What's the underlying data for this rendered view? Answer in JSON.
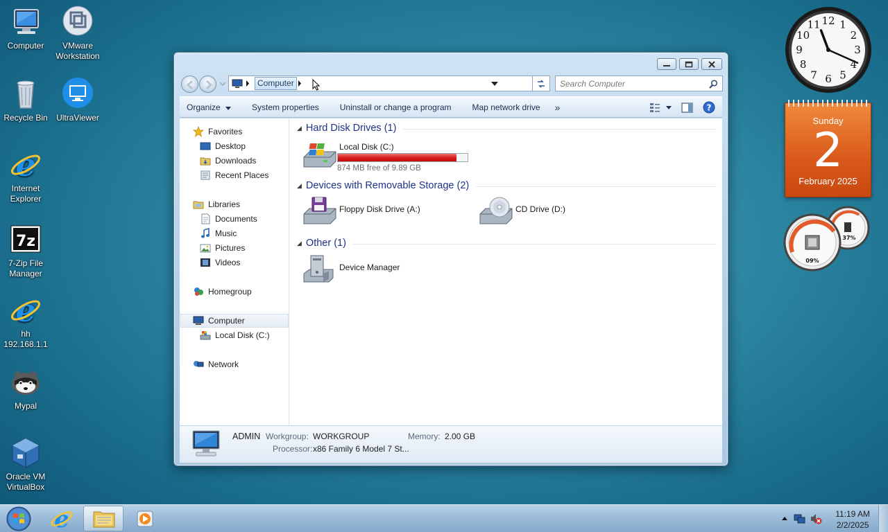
{
  "desktop": {
    "icons": [
      {
        "label": "Computer",
        "icon": "computer-icon"
      },
      {
        "label": "VMware\nWorkstation",
        "icon": "vmware-icon"
      },
      {
        "label": "Recycle Bin",
        "icon": "recycle-bin-icon"
      },
      {
        "label": "UltraViewer",
        "icon": "ultraviewer-icon"
      },
      {
        "label": "Internet\nExplorer",
        "icon": "internet-explorer-icon"
      },
      {
        "label": "7-Zip File\nManager",
        "icon": "7zip-icon"
      },
      {
        "label": "hh\n192.168.1.1",
        "icon": "internet-explorer-icon"
      },
      {
        "label": "Mypal",
        "icon": "mypal-icon"
      },
      {
        "label": "Oracle VM\nVirtualBox",
        "icon": "virtualbox-icon"
      }
    ]
  },
  "window": {
    "address": {
      "crumb": "Computer"
    },
    "search": {
      "placeholder": "Search Computer"
    },
    "toolbar": {
      "organize": "Organize",
      "system_properties": "System properties",
      "uninstall": "Uninstall or change a program",
      "map_drive": "Map network drive",
      "more": "»"
    },
    "nav": {
      "favorites": "Favorites",
      "desktop": "Desktop",
      "downloads": "Downloads",
      "recent_places": "Recent Places",
      "libraries": "Libraries",
      "documents": "Documents",
      "music": "Music",
      "pictures": "Pictures",
      "videos": "Videos",
      "homegroup": "Homegroup",
      "computer": "Computer",
      "local_disk": "Local Disk (C:)",
      "network": "Network"
    },
    "groups": {
      "hdd": "Hard Disk Drives (1)",
      "removable": "Devices with Removable Storage (2)",
      "other": "Other (1)"
    },
    "items": {
      "local_disk": {
        "name": "Local Disk (C:)",
        "free": "874 MB free of 9.89 GB",
        "used_fraction": 0.914
      },
      "floppy": {
        "name": "Floppy Disk Drive (A:)"
      },
      "cd": {
        "name": "CD Drive (D:)"
      },
      "device_manager": {
        "name": "Device Manager"
      }
    },
    "details": {
      "name": "ADMIN",
      "workgroup_label": "Workgroup:",
      "workgroup": "WORKGROUP",
      "memory_label": "Memory:",
      "memory": "2.00 GB",
      "processor_label": "Processor:",
      "processor": "x86 Family 6 Model 7 St..."
    }
  },
  "gadgets": {
    "clock": {
      "hour": 11,
      "minute": 19
    },
    "calendar": {
      "weekday": "Sunday",
      "day": "2",
      "month_year": "February 2025"
    },
    "meter": {
      "cpu": "09%",
      "ram": "37%"
    }
  },
  "taskbar": {
    "time": "11:19 AM",
    "date": "2/2/2025"
  },
  "colors": {
    "accent": "#1e3287",
    "disk_bar": "#d21a1a"
  }
}
